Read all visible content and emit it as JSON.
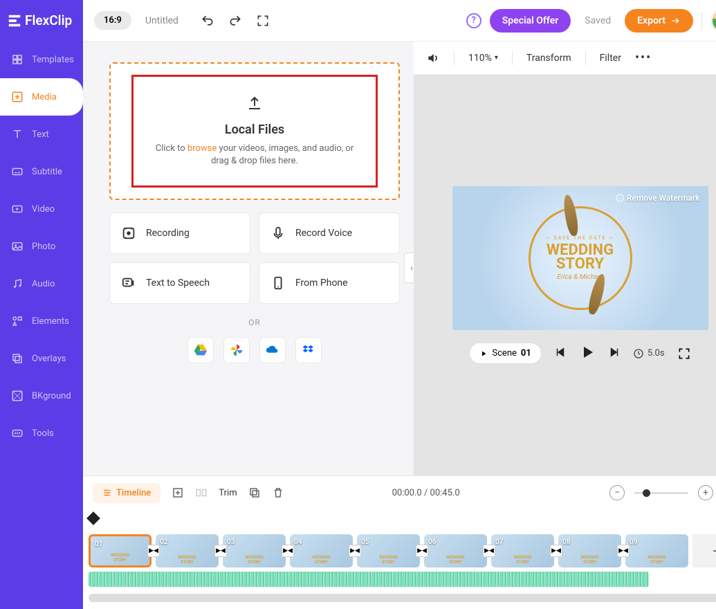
{
  "brand": "FlexClip",
  "header": {
    "aspect": "16:9",
    "title": "Untitled",
    "offer": "Special Offer",
    "saved": "Saved",
    "export": "Export"
  },
  "sidebar": {
    "items": [
      {
        "label": "Templates"
      },
      {
        "label": "Media"
      },
      {
        "label": "Text"
      },
      {
        "label": "Subtitle"
      },
      {
        "label": "Video"
      },
      {
        "label": "Photo"
      },
      {
        "label": "Audio"
      },
      {
        "label": "Elements"
      },
      {
        "label": "Overlays"
      },
      {
        "label": "BKground"
      },
      {
        "label": "Tools"
      }
    ]
  },
  "media": {
    "upload_title": "Local Files",
    "upload_sub_pre": "Click to ",
    "upload_browse": "browse",
    "upload_sub_post": " your videos, images, and audio, or drag & drop files here.",
    "recording": "Recording",
    "record_voice": "Record Voice",
    "tts": "Text to Speech",
    "from_phone": "From Phone",
    "or": "OR"
  },
  "preview": {
    "zoom": "110%",
    "transform": "Transform",
    "filter": "Filter",
    "remove_wm": "Remove Watermark",
    "save_date": "— SAVE THE DATE —",
    "wedding_line1": "WEDDING",
    "wedding_line2": "STORY",
    "names": "Erica & Michael",
    "scene_label": "Scene",
    "scene_num": "01",
    "duration": "5.0s"
  },
  "timeline": {
    "label": "Timeline",
    "trim": "Trim",
    "time_current": "00:00.0",
    "time_total": "00:45.0",
    "clips": [
      "01",
      "02",
      "03",
      "04",
      "05",
      "06",
      "07",
      "08",
      "09"
    ]
  }
}
